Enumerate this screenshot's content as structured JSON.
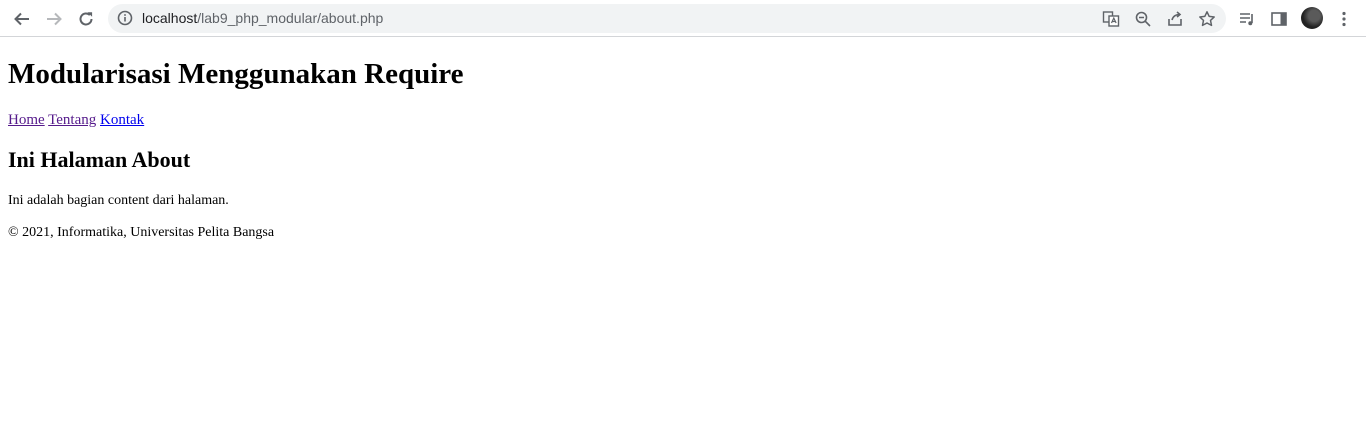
{
  "browser": {
    "url_host": "localhost",
    "url_path": "/lab9_php_modular/about.php"
  },
  "page": {
    "title": "Modularisasi Menggunakan Require",
    "nav": [
      {
        "label": "Home"
      },
      {
        "label": "Tentang"
      },
      {
        "label": "Kontak"
      }
    ],
    "heading": "Ini Halaman About",
    "content": "Ini adalah bagian content dari halaman.",
    "footer": "© 2021, Informatika, Universitas Pelita Bangsa"
  }
}
